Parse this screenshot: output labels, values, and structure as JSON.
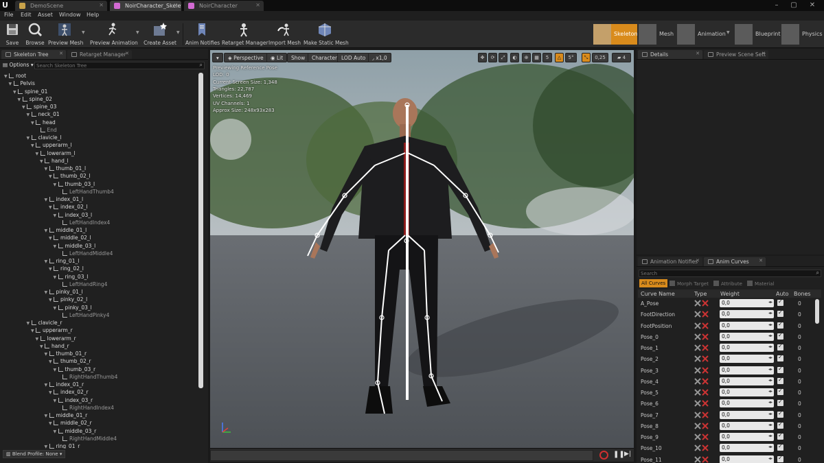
{
  "title_tabs": [
    {
      "label": "DemoScene",
      "active": false,
      "icon_color": "#c8a24a"
    },
    {
      "label": "NoirCharacter_Skeleton",
      "active": true,
      "icon_color": "#d26ad2"
    },
    {
      "label": "NoirCharacter",
      "active": false,
      "icon_color": "#d26ad2"
    }
  ],
  "menu": [
    "File",
    "Edit",
    "Asset",
    "Window",
    "Help"
  ],
  "toolbar": {
    "save": "Save",
    "browse": "Browse",
    "preview_mesh": "Preview Mesh",
    "preview_animation": "Preview Animation",
    "create_asset": "Create Asset",
    "anim_notifies": "Anim Notifies",
    "retarget_manager": "Retarget Manager",
    "import_mesh": "Import Mesh",
    "make_static_mesh": "Make Static Mesh"
  },
  "modes": {
    "skeleton": "Skeleton",
    "mesh": "Mesh",
    "animation": "Animation",
    "blueprint": "Blueprint",
    "physics": "Physics"
  },
  "left_panel": {
    "tabs": [
      "Skeleton Tree",
      "Retarget Manager"
    ],
    "options_label": "Options",
    "search_placeholder": "Search Skeleton Tree",
    "blend_profile": "Blend Profile: None",
    "bones": [
      {
        "name": "root",
        "depth": 0
      },
      {
        "name": "Pelvis",
        "depth": 1
      },
      {
        "name": "spine_01",
        "depth": 2
      },
      {
        "name": "spine_02",
        "depth": 3
      },
      {
        "name": "spine_03",
        "depth": 4
      },
      {
        "name": "neck_01",
        "depth": 5
      },
      {
        "name": "head",
        "depth": 6
      },
      {
        "name": "End",
        "depth": 7,
        "leaf": true
      },
      {
        "name": "clavicle_l",
        "depth": 5
      },
      {
        "name": "upperarm_l",
        "depth": 6
      },
      {
        "name": "lowerarm_l",
        "depth": 7
      },
      {
        "name": "hand_l",
        "depth": 8
      },
      {
        "name": "thumb_01_l",
        "depth": 9
      },
      {
        "name": "thumb_02_l",
        "depth": 10
      },
      {
        "name": "thumb_03_l",
        "depth": 11
      },
      {
        "name": "LeftHandThumb4",
        "depth": 12,
        "leaf": true
      },
      {
        "name": "index_01_l",
        "depth": 9
      },
      {
        "name": "index_02_l",
        "depth": 10
      },
      {
        "name": "index_03_l",
        "depth": 11
      },
      {
        "name": "LeftHandIndex4",
        "depth": 12,
        "leaf": true
      },
      {
        "name": "middle_01_l",
        "depth": 9
      },
      {
        "name": "middle_02_l",
        "depth": 10
      },
      {
        "name": "middle_03_l",
        "depth": 11
      },
      {
        "name": "LeftHandMiddle4",
        "depth": 12,
        "leaf": true
      },
      {
        "name": "ring_01_l",
        "depth": 9
      },
      {
        "name": "ring_02_l",
        "depth": 10
      },
      {
        "name": "ring_03_l",
        "depth": 11
      },
      {
        "name": "LeftHandRing4",
        "depth": 12,
        "leaf": true
      },
      {
        "name": "pinky_01_l",
        "depth": 9
      },
      {
        "name": "pinky_02_l",
        "depth": 10
      },
      {
        "name": "pinky_03_l",
        "depth": 11
      },
      {
        "name": "LeftHandPinky4",
        "depth": 12,
        "leaf": true
      },
      {
        "name": "clavicle_r",
        "depth": 5
      },
      {
        "name": "upperarm_r",
        "depth": 6
      },
      {
        "name": "lowerarm_r",
        "depth": 7
      },
      {
        "name": "hand_r",
        "depth": 8
      },
      {
        "name": "thumb_01_r",
        "depth": 9
      },
      {
        "name": "thumb_02_r",
        "depth": 10
      },
      {
        "name": "thumb_03_r",
        "depth": 11
      },
      {
        "name": "RightHandThumb4",
        "depth": 12,
        "leaf": true
      },
      {
        "name": "index_01_r",
        "depth": 9
      },
      {
        "name": "index_02_r",
        "depth": 10
      },
      {
        "name": "index_03_r",
        "depth": 11
      },
      {
        "name": "RightHandIndex4",
        "depth": 12,
        "leaf": true
      },
      {
        "name": "middle_01_r",
        "depth": 9
      },
      {
        "name": "middle_02_r",
        "depth": 10
      },
      {
        "name": "middle_03_r",
        "depth": 11
      },
      {
        "name": "RightHandMiddle4",
        "depth": 12,
        "leaf": true
      },
      {
        "name": "ring_01_r",
        "depth": 9
      }
    ]
  },
  "viewport": {
    "buttons": {
      "perspective": "Perspective",
      "lit": "Lit",
      "show": "Show",
      "character": "Character",
      "lod": "LOD Auto",
      "speed": "x1,0"
    },
    "info": [
      "Previewing Reference Pose",
      "LOD: 0",
      "Current Screen Size: 1,348",
      "Triangles: 22,787",
      "Vertices: 14,469",
      "UV Channels: 1",
      "Approx Size: 248x93x283"
    ],
    "grid_value": "5",
    "angle_value": "5°",
    "scale_value": "0,25",
    "camera_speed": "4"
  },
  "right_panel": {
    "top_tabs": [
      "Details",
      "Preview Scene Sett"
    ],
    "bottom_tabs": [
      "Animation Notifies",
      "Anim Curves"
    ],
    "search_placeholder": "Search",
    "filters": {
      "all": "All Curves",
      "morph": "Morph Target",
      "attribute": "Attribute",
      "material": "Material"
    },
    "columns": {
      "name": "Curve Name",
      "type": "Type",
      "weight": "Weight",
      "auto": "Auto",
      "bones": "Bones"
    },
    "curves": [
      {
        "name": "A_Pose",
        "weight": "0,0",
        "bones": "0"
      },
      {
        "name": "FootDirection",
        "weight": "0,0",
        "bones": "0"
      },
      {
        "name": "FootPosition",
        "weight": "0,0",
        "bones": "0"
      },
      {
        "name": "Pose_0",
        "weight": "0,0",
        "bones": "0"
      },
      {
        "name": "Pose_1",
        "weight": "0,0",
        "bones": "0"
      },
      {
        "name": "Pose_2",
        "weight": "0,0",
        "bones": "0"
      },
      {
        "name": "Pose_3",
        "weight": "0,0",
        "bones": "0"
      },
      {
        "name": "Pose_4",
        "weight": "0,0",
        "bones": "0"
      },
      {
        "name": "Pose_5",
        "weight": "0,0",
        "bones": "0"
      },
      {
        "name": "Pose_6",
        "weight": "0,0",
        "bones": "0"
      },
      {
        "name": "Pose_7",
        "weight": "0,0",
        "bones": "0"
      },
      {
        "name": "Pose_8",
        "weight": "0,0",
        "bones": "0"
      },
      {
        "name": "Pose_9",
        "weight": "0,0",
        "bones": "0"
      },
      {
        "name": "Pose_10",
        "weight": "0,0",
        "bones": "0"
      },
      {
        "name": "Pose_11",
        "weight": "0,0",
        "bones": "0"
      }
    ]
  },
  "colors": {
    "accent": "#d98b1c",
    "panel": "#202020",
    "toolbar": "#2b2b2b"
  }
}
